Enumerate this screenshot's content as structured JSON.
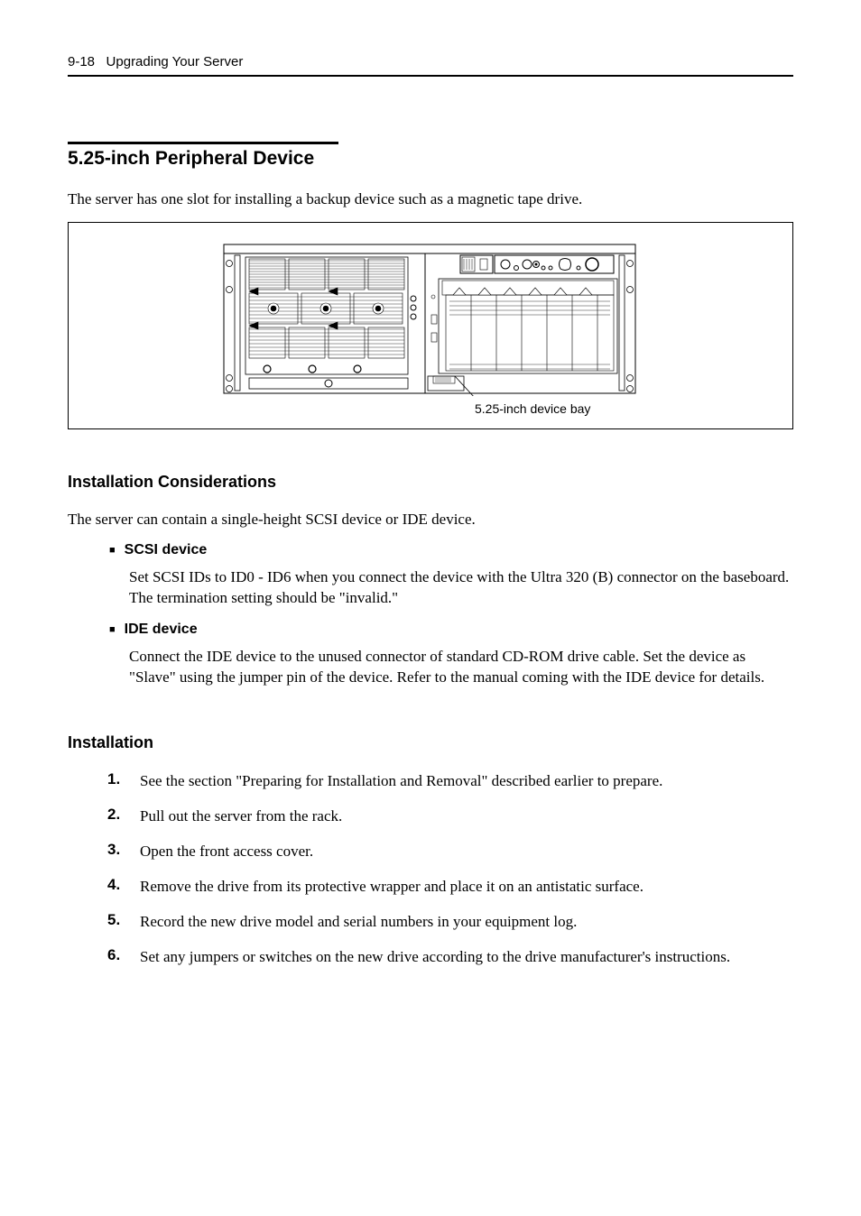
{
  "header": {
    "page_num": "9-18",
    "chapter": "Upgrading Your Server"
  },
  "section": {
    "title": "5.25-inch Peripheral Device",
    "intro": "The server has one slot for installing a backup device such as a magnetic tape drive."
  },
  "figure": {
    "caption": "5.25-inch device bay"
  },
  "considerations": {
    "title": "Installation Considerations",
    "intro": "The server can contain a single-height SCSI device or IDE device.",
    "items": [
      {
        "label": "SCSI device",
        "text": "Set SCSI IDs to ID0 - ID6 when you connect the device with the Ultra 320 (B) connector on the baseboard. The termination setting should be \"invalid.\""
      },
      {
        "label": "IDE device",
        "text": "Connect the IDE device to the unused connector of standard CD-ROM drive cable. Set the device as \"Slave\" using the jumper pin of the device. Refer to the manual coming with the IDE device for details."
      }
    ]
  },
  "installation": {
    "title": "Installation",
    "steps": [
      "See the section \"Preparing for Installation and Removal\" described earlier to prepare.",
      "Pull out the server from the rack.",
      "Open the front access cover.",
      "Remove the drive from its protective wrapper and place it on an antistatic surface.",
      "Record the new drive model and serial numbers in your equipment log.",
      "Set any jumpers or switches on the new drive according to the drive manufacturer's instructions."
    ]
  }
}
